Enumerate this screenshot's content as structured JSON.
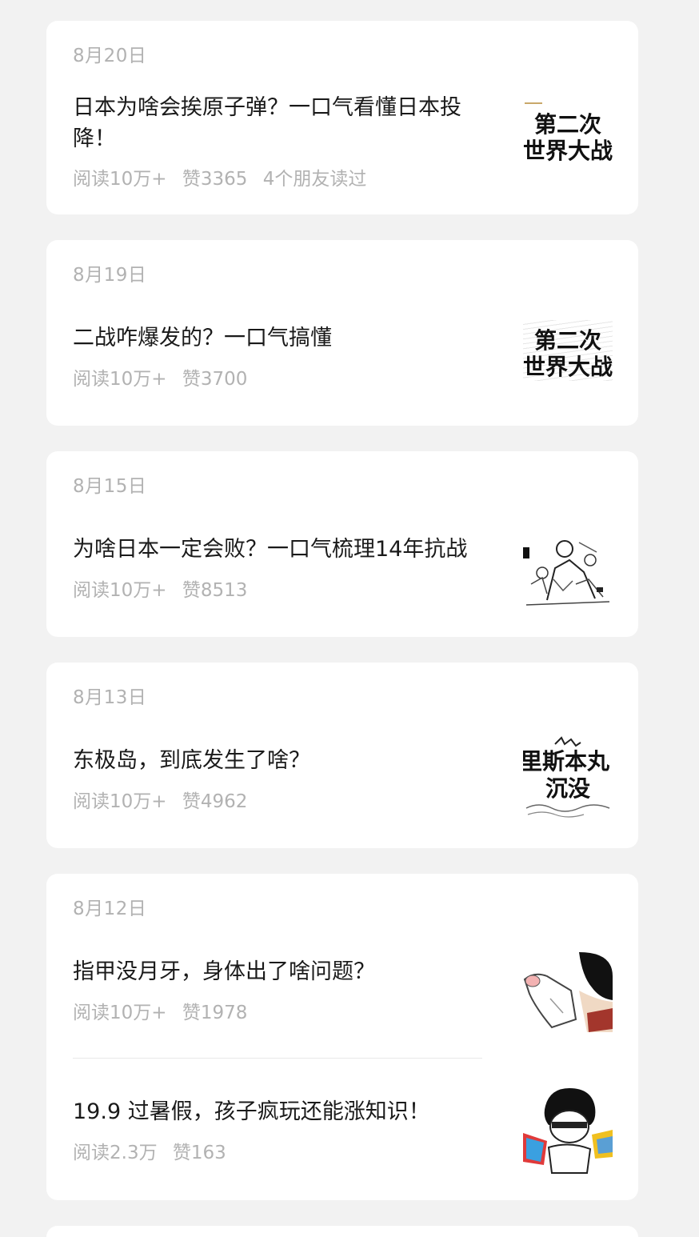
{
  "feed": [
    {
      "date": "8月20日",
      "articles": [
        {
          "title": "日本为啥会挨原子弹？一口气看懂日本投降！",
          "meta": [
            "阅读10万+",
            "赞3365",
            "4个朋友读过"
          ],
          "thumb": {
            "icon": "ww2-title-thumbnail",
            "text_lines": [
              "第二次",
              "世界大战"
            ]
          }
        }
      ]
    },
    {
      "date": "8月19日",
      "articles": [
        {
          "title": "二战咋爆发的？一口气搞懂",
          "meta": [
            "阅读10万+",
            "赞3700"
          ],
          "thumb": {
            "icon": "ww2-title-thumbnail",
            "text_lines": [
              "第二次",
              "世界大战"
            ]
          }
        }
      ]
    },
    {
      "date": "8月15日",
      "articles": [
        {
          "title": "为啥日本一定会败？一口气梳理14年抗战",
          "meta": [
            "阅读10万+",
            "赞8513"
          ],
          "thumb": {
            "icon": "battle-sketch-thumbnail",
            "text_lines": []
          }
        }
      ]
    },
    {
      "date": "8月13日",
      "articles": [
        {
          "title": "东极岛，到底发生了啥？",
          "meta": [
            "阅读10万+",
            "赞4962"
          ],
          "thumb": {
            "icon": "shipwreck-title-thumbnail",
            "text_lines": [
              "里斯本丸",
              "沉没"
            ]
          }
        }
      ]
    },
    {
      "date": "8月12日",
      "articles": [
        {
          "title": "指甲没月牙，身体出了啥问题？",
          "meta": [
            "阅读10万+",
            "赞1978"
          ],
          "thumb": {
            "icon": "fingernail-cartoon-thumbnail",
            "text_lines": []
          }
        },
        {
          "title": "19.9 过暑假，孩子疯玩还能涨知识！",
          "meta": [
            "阅读2.3万",
            "赞163"
          ],
          "thumb": {
            "icon": "kid-cartoon-thumbnail",
            "text_lines": []
          }
        }
      ]
    }
  ]
}
